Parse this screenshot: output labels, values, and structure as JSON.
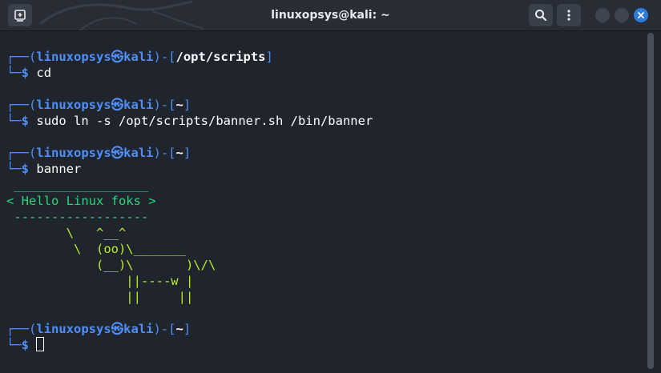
{
  "window": {
    "title": "linuxopsys@kali: ~"
  },
  "prompt": {
    "user": "linuxopsys",
    "at": "㉿",
    "host": "kali",
    "dollar": "$"
  },
  "blocks": [
    {
      "dir": "/opt/scripts",
      "command": "cd"
    },
    {
      "dir": "~",
      "command": "sudo ln -s /opt/scripts/banner.sh /bin/banner"
    },
    {
      "dir": "~",
      "command": "banner"
    },
    {
      "dir": "~",
      "command": ""
    }
  ],
  "output": {
    "box_top": " __________________",
    "box_text": "< Hello Linux foks >",
    "box_bottom": " ------------------",
    "cow": [
      "        \\   ^__^",
      "         \\  (oo)\\_______",
      "            (__)\\       )\\/\\",
      "                ||----w |",
      "                ||     ||"
    ]
  },
  "colors": {
    "prompt_frame": "#4f8ff7",
    "output_green": "#29d67c",
    "cow_yellow": "#b9ef28",
    "close_button": "#2f7bd9"
  },
  "icons": {
    "new_tab": "new-tab-icon",
    "search": "search-icon",
    "menu": "kebab-menu-icon",
    "close": "close-icon"
  }
}
